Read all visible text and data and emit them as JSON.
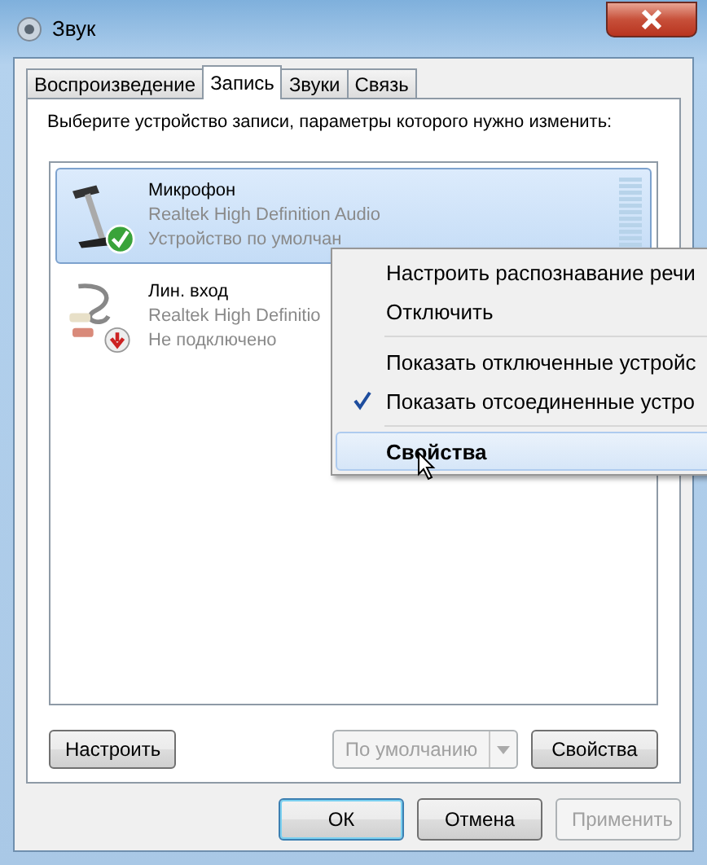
{
  "window": {
    "title": "Звук"
  },
  "tabs": [
    {
      "label": "Воспроизведение",
      "selected": false
    },
    {
      "label": "Запись",
      "selected": true
    },
    {
      "label": "Звуки",
      "selected": false
    },
    {
      "label": "Связь",
      "selected": false
    }
  ],
  "instruction": "Выберите устройство записи, параметры которого нужно изменить:",
  "devices": [
    {
      "kind": "microphone",
      "name": "Микрофон",
      "driver": "Realtek High Definition Audio",
      "status": "Устройство по умолчан",
      "is_default": true,
      "connected": true,
      "selected": true
    },
    {
      "kind": "line_in",
      "name": "Лин. вход",
      "driver": "Realtek High Definitio",
      "status": "Не подключено",
      "is_default": false,
      "connected": false,
      "selected": false
    }
  ],
  "context_menu": {
    "groups": [
      [
        {
          "label": "Настроить распознавание речи",
          "checked": false,
          "bold": false,
          "selected": false
        },
        {
          "label": "Отключить",
          "checked": false,
          "bold": false,
          "selected": false
        }
      ],
      [
        {
          "label": "Показать отключенные устройс",
          "checked": false,
          "bold": false,
          "selected": false
        },
        {
          "label": "Показать отсоединенные устро",
          "checked": true,
          "bold": false,
          "selected": false
        }
      ],
      [
        {
          "label": "Свойства",
          "checked": false,
          "bold": true,
          "selected": true
        }
      ]
    ]
  },
  "panel_buttons": [
    {
      "kind": "button",
      "label": "Настроить",
      "disabled": false
    },
    {
      "kind": "split",
      "label": "По умолчанию",
      "disabled": true
    },
    {
      "kind": "button",
      "label": "Свойства",
      "disabled": false
    }
  ],
  "dialog_buttons": [
    {
      "label": "ОК",
      "default": true,
      "disabled": false
    },
    {
      "label": "Отмена",
      "default": false,
      "disabled": false
    },
    {
      "label": "Применить",
      "default": false,
      "disabled": true
    }
  ]
}
